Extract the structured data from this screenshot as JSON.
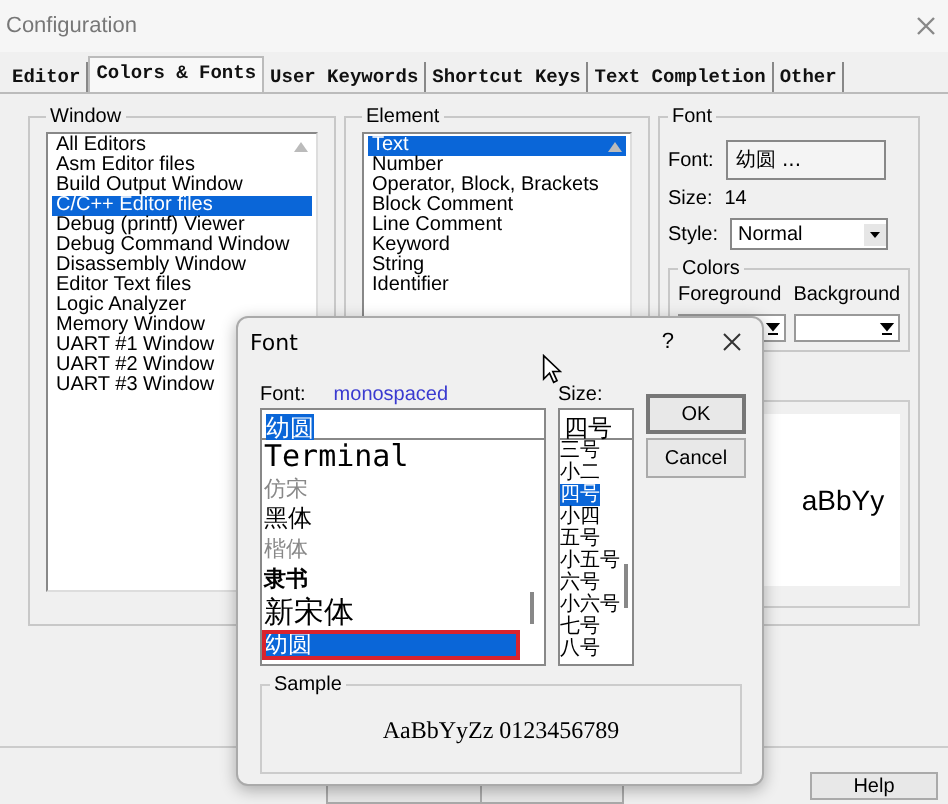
{
  "window": {
    "title": "Configuration"
  },
  "tabs": [
    {
      "label": "Editor",
      "selected": false
    },
    {
      "label": "Colors & Fonts",
      "selected": true
    },
    {
      "label": "User Keywords",
      "selected": false
    },
    {
      "label": "Shortcut Keys",
      "selected": false
    },
    {
      "label": "Text Completion",
      "selected": false
    },
    {
      "label": "Other",
      "selected": false
    }
  ],
  "window_group": {
    "label": "Window",
    "items": [
      {
        "label": "All Editors",
        "selected": false
      },
      {
        "label": "Asm Editor files",
        "selected": false
      },
      {
        "label": "Build Output Window",
        "selected": false
      },
      {
        "label": "C/C++ Editor files",
        "selected": true
      },
      {
        "label": "Debug (printf) Viewer",
        "selected": false
      },
      {
        "label": "Debug Command Window",
        "selected": false
      },
      {
        "label": "Disassembly Window",
        "selected": false
      },
      {
        "label": "Editor Text files",
        "selected": false
      },
      {
        "label": "Logic Analyzer",
        "selected": false
      },
      {
        "label": "Memory Window",
        "selected": false
      },
      {
        "label": "UART #1 Window",
        "selected": false
      },
      {
        "label": "UART #2 Window",
        "selected": false
      },
      {
        "label": "UART #3 Window",
        "selected": false
      }
    ]
  },
  "element_group": {
    "label": "Element",
    "items": [
      {
        "label": "Text",
        "selected": true
      },
      {
        "label": "Number",
        "selected": false
      },
      {
        "label": "Operator, Block, Brackets",
        "selected": false
      },
      {
        "label": "Block Comment",
        "selected": false
      },
      {
        "label": "Line Comment",
        "selected": false
      },
      {
        "label": "Keyword",
        "selected": false
      },
      {
        "label": "String",
        "selected": false
      },
      {
        "label": "Identifier",
        "selected": false
      }
    ]
  },
  "font_group": {
    "label": "Font",
    "font_label": "Font:",
    "font_button": "幼圆 ...",
    "size_label": "Size:",
    "size_value": "14",
    "style_label": "Style:",
    "style_value": "Normal",
    "colors_label": "Colors",
    "foreground": "Foreground",
    "background": "Background",
    "sample": "aBbYy"
  },
  "buttons": [
    {
      "label": "Help"
    }
  ],
  "font_dialog": {
    "title": "Font",
    "help": "?",
    "font_label": "Font:",
    "font_hint": "monospaced",
    "font_value": "幼圆",
    "fonts": [
      {
        "label": "Terminal",
        "kind": "mono",
        "selected": false
      },
      {
        "label": "仿宋",
        "kind": "light",
        "selected": false
      },
      {
        "label": "黑体",
        "kind": "regular",
        "selected": false
      },
      {
        "label": "楷体",
        "kind": "light",
        "selected": false
      },
      {
        "label": "隶书",
        "kind": "heavy",
        "selected": false
      },
      {
        "label": "新宋体",
        "kind": "large",
        "selected": false
      },
      {
        "label": "幼圆",
        "kind": "regular",
        "selected": true
      }
    ],
    "size_label": "Size:",
    "size_value": "四号",
    "sizes": [
      {
        "label": "三号",
        "selected": false
      },
      {
        "label": "小二",
        "selected": false
      },
      {
        "label": "四号",
        "selected": true
      },
      {
        "label": "小四",
        "selected": false
      },
      {
        "label": "五号",
        "selected": false
      },
      {
        "label": "小五号",
        "selected": false
      },
      {
        "label": "六号",
        "selected": false
      },
      {
        "label": "小六号",
        "selected": false
      },
      {
        "label": "七号",
        "selected": false
      },
      {
        "label": "八号",
        "selected": false
      }
    ],
    "ok": "OK",
    "cancel": "Cancel",
    "sample_label": "Sample",
    "sample": "AaBbYyZz 0123456789"
  }
}
